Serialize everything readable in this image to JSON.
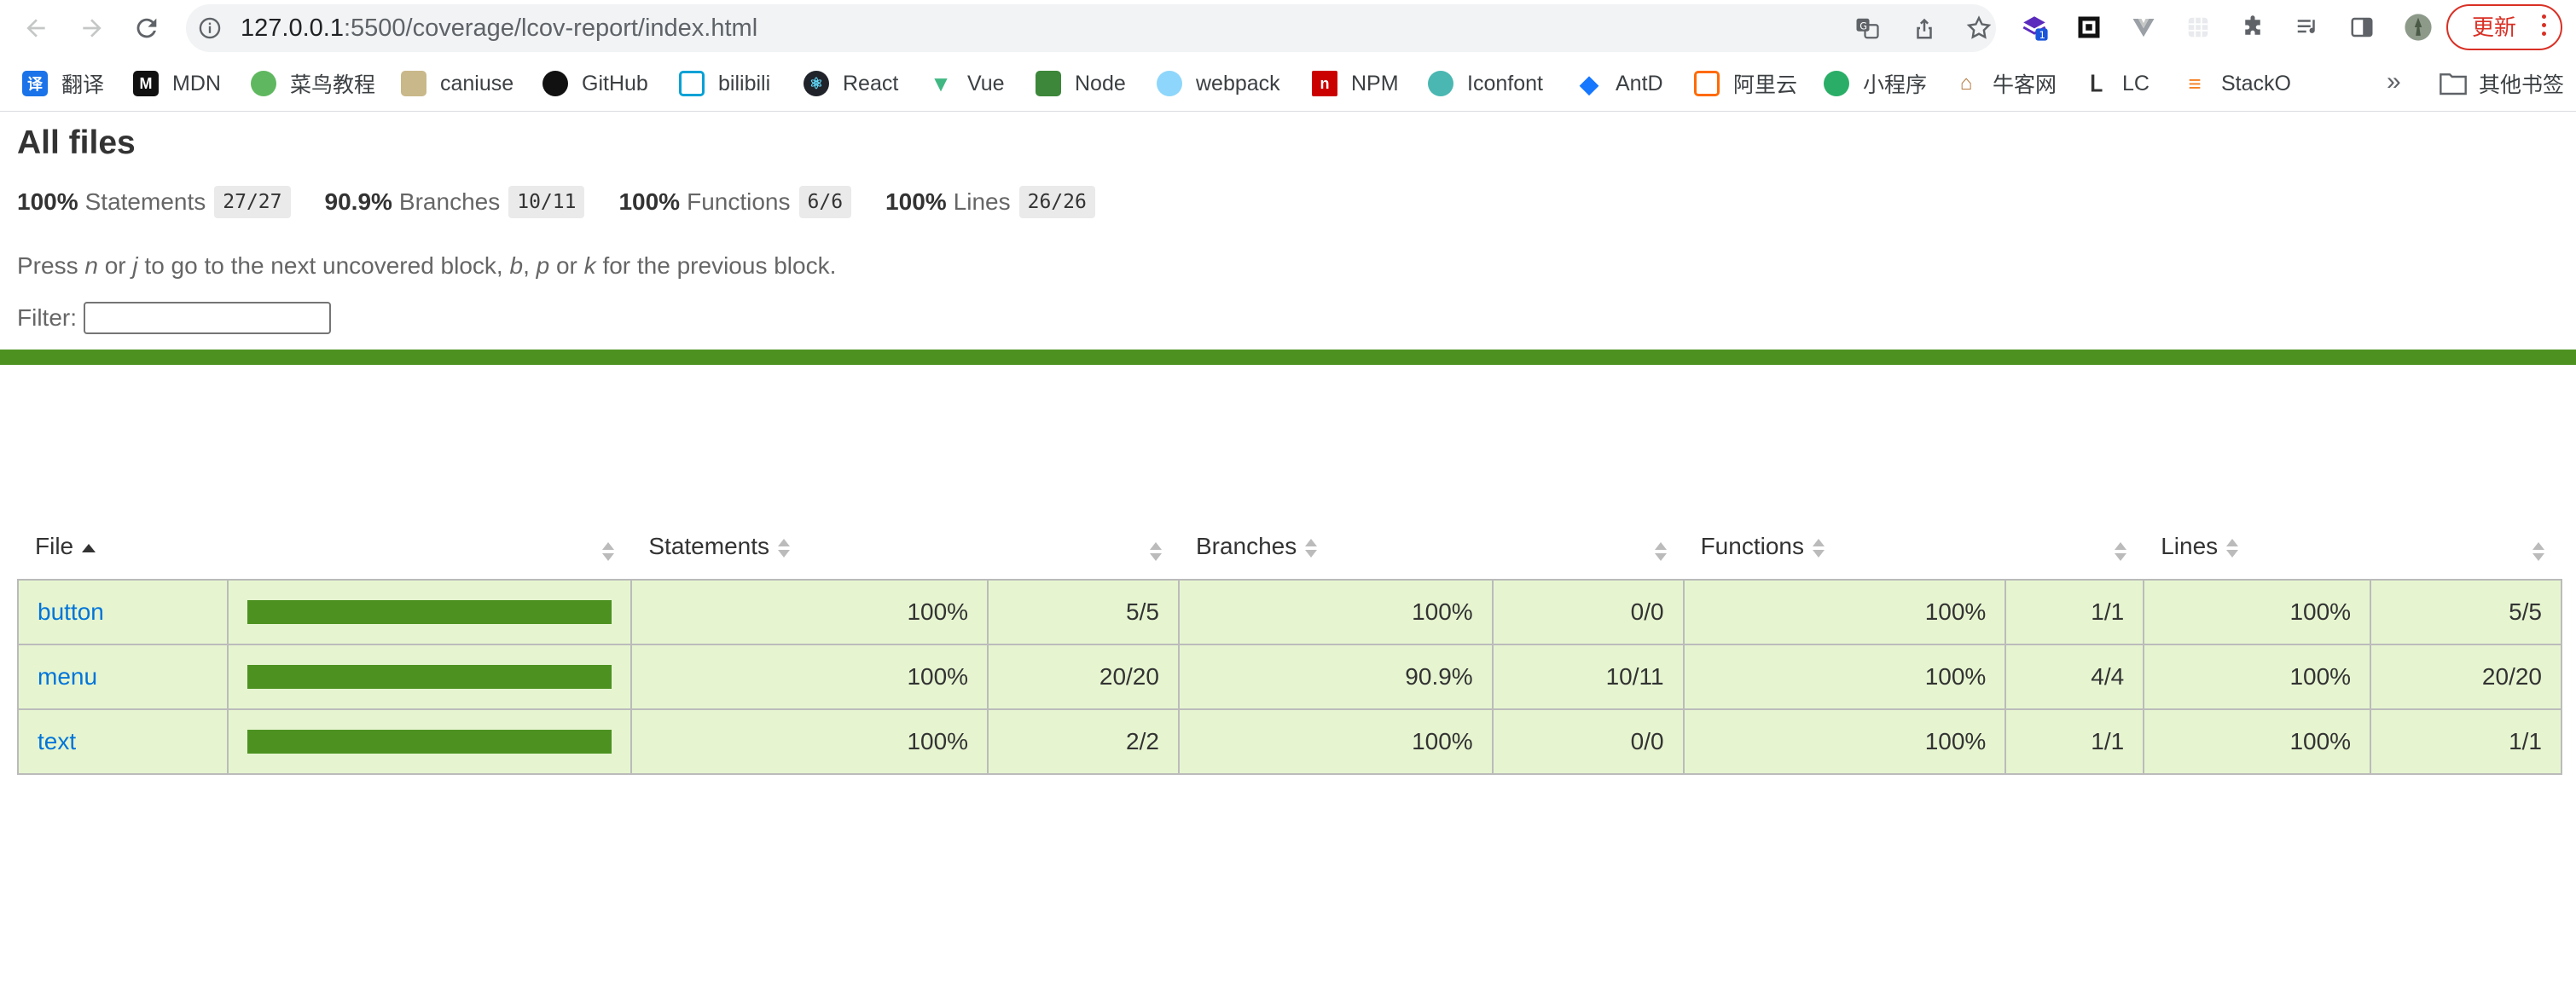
{
  "browser": {
    "url_host": "127.0.0.1",
    "url_path": ":5500/coverage/lcov-report/index.html",
    "update_label": "更新",
    "extension_badge": "1"
  },
  "bookmarks": {
    "items": [
      {
        "label": "翻译",
        "icon": "translate-icon"
      },
      {
        "label": "MDN",
        "icon": "mdn-icon"
      },
      {
        "label": "菜鸟教程",
        "icon": "runoob-icon"
      },
      {
        "label": "caniuse",
        "icon": "caniuse-icon"
      },
      {
        "label": "GitHub",
        "icon": "github-icon"
      },
      {
        "label": "bilibili",
        "icon": "bilibili-icon"
      },
      {
        "label": "React",
        "icon": "react-icon"
      },
      {
        "label": "Vue",
        "icon": "vue-icon"
      },
      {
        "label": "Node",
        "icon": "node-icon"
      },
      {
        "label": "webpack",
        "icon": "webpack-icon"
      },
      {
        "label": "NPM",
        "icon": "npm-icon"
      },
      {
        "label": "Iconfont",
        "icon": "iconfont-icon"
      },
      {
        "label": "AntD",
        "icon": "antd-icon"
      },
      {
        "label": "阿里云",
        "icon": "aliyun-icon"
      },
      {
        "label": "小程序",
        "icon": "wechat-miniprogram-icon"
      },
      {
        "label": "牛客网",
        "icon": "nowcoder-icon"
      },
      {
        "label": "LC",
        "icon": "leetcode-icon"
      },
      {
        "label": "StackO",
        "icon": "stackoverflow-icon"
      }
    ],
    "more": "»",
    "folder_label": "其他书签"
  },
  "report": {
    "title": "All files",
    "summary": [
      {
        "pct": "100%",
        "label": "Statements",
        "fraction": "27/27"
      },
      {
        "pct": "90.9%",
        "label": "Branches",
        "fraction": "10/11"
      },
      {
        "pct": "100%",
        "label": "Functions",
        "fraction": "6/6"
      },
      {
        "pct": "100%",
        "label": "Lines",
        "fraction": "26/26"
      }
    ],
    "hint": {
      "p1": "Press ",
      "k1": "n",
      "p2": " or ",
      "k2": "j",
      "p3": " to go to the next uncovered block, ",
      "k3": "b",
      "p4": ", ",
      "k4": "p",
      "p5": " or ",
      "k5": "k",
      "p6": " for the previous block."
    },
    "filter_label": "Filter:",
    "filter_value": "",
    "status_color": "#4d9221",
    "columns": {
      "file": "File",
      "statements": "Statements",
      "branches": "Branches",
      "functions": "Functions",
      "lines": "Lines"
    },
    "rows": [
      {
        "file": "button",
        "coverage": 1.0,
        "stmt_pct": "100%",
        "stmt_frac": "5/5",
        "br_pct": "100%",
        "br_frac": "0/0",
        "fn_pct": "100%",
        "fn_frac": "1/1",
        "ln_pct": "100%",
        "ln_frac": "5/5"
      },
      {
        "file": "menu",
        "coverage": 1.0,
        "stmt_pct": "100%",
        "stmt_frac": "20/20",
        "br_pct": "90.9%",
        "br_frac": "10/11",
        "fn_pct": "100%",
        "fn_frac": "4/4",
        "ln_pct": "100%",
        "ln_frac": "20/20"
      },
      {
        "file": "text",
        "coverage": 1.0,
        "stmt_pct": "100%",
        "stmt_frac": "2/2",
        "br_pct": "100%",
        "br_frac": "0/0",
        "fn_pct": "100%",
        "fn_frac": "1/1",
        "ln_pct": "100%",
        "ln_frac": "1/1"
      }
    ]
  }
}
